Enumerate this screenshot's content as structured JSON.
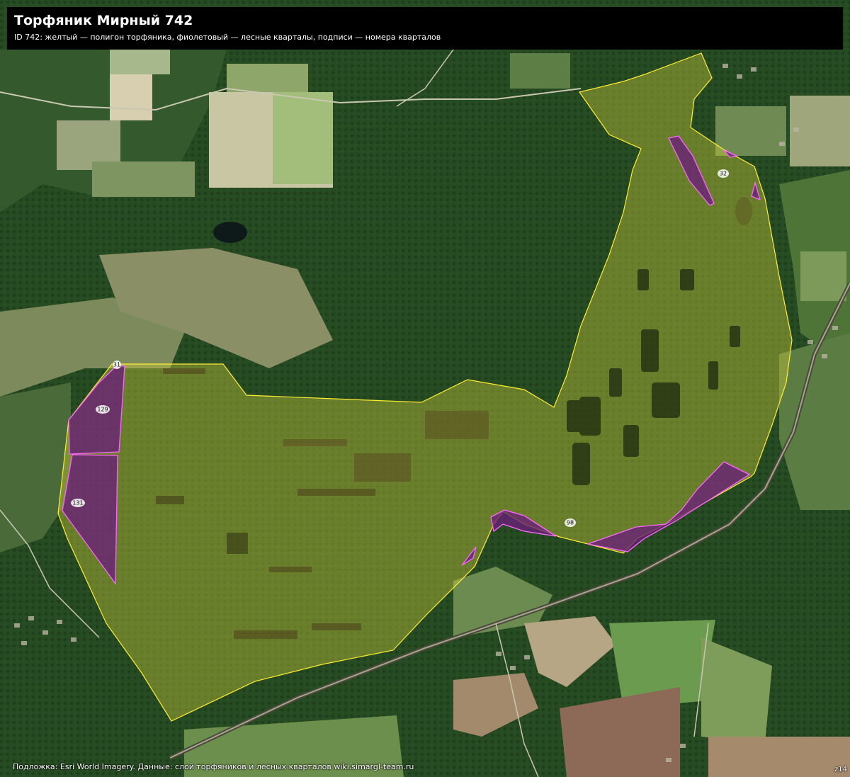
{
  "title": "Торфяник Мирный 742",
  "subtitle": "ID 742: желтый — полигон торфяника, фиолетовый — лесные кварталы, подписи — номера кварталов",
  "footer": "Подложка: Esri World Imagery. Данные: слой торфяников и лесных кварталов wiki.simargl-team.ru",
  "zoom_label": "z14",
  "colors": {
    "peat_fill": "#c8c83a",
    "peat_stroke": "#ffee33",
    "quarter_fill": "#6a1f7a",
    "quarter_stroke": "#ff66ff"
  },
  "quarters": [
    {
      "id": "q31",
      "label": "31"
    },
    {
      "id": "q129",
      "label": "129"
    },
    {
      "id": "q131",
      "label": "131"
    },
    {
      "id": "q32",
      "label": "32"
    },
    {
      "id": "q98",
      "label": "98"
    }
  ]
}
